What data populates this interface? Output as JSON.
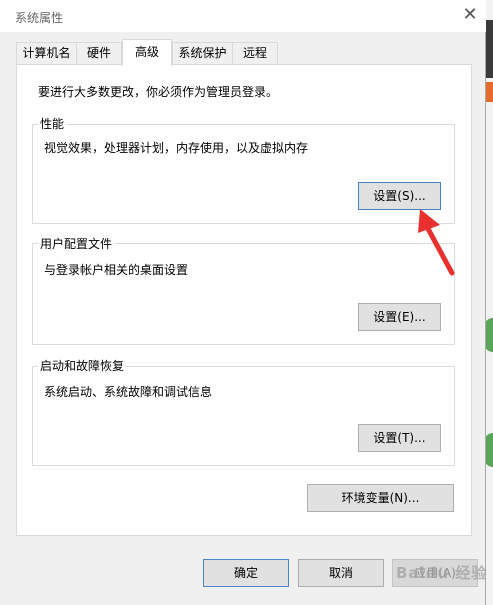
{
  "window": {
    "title": "系统属性"
  },
  "tabs": [
    {
      "label": "计算机名"
    },
    {
      "label": "硬件"
    },
    {
      "label": "高级"
    },
    {
      "label": "系统保护"
    },
    {
      "label": "远程"
    }
  ],
  "admin_note": "要进行大多数更改，你必须作为管理员登录。",
  "performance": {
    "title": "性能",
    "desc": "视觉效果，处理器计划，内存使用，以及虚拟内存",
    "button": "设置(S)..."
  },
  "profile": {
    "title": "用户配置文件",
    "desc": "与登录帐户相关的桌面设置",
    "button": "设置(E)..."
  },
  "startup": {
    "title": "启动和故障恢复",
    "desc": "系统启动、系统故障和调试信息",
    "button": "设置(T)..."
  },
  "env_button": "环境变量(N)...",
  "footer": {
    "ok": "确定",
    "cancel": "取消",
    "apply": "应用(A)"
  },
  "watermark": "Baidu 经验",
  "colors": {
    "annotation_arrow": "#e8312f"
  }
}
